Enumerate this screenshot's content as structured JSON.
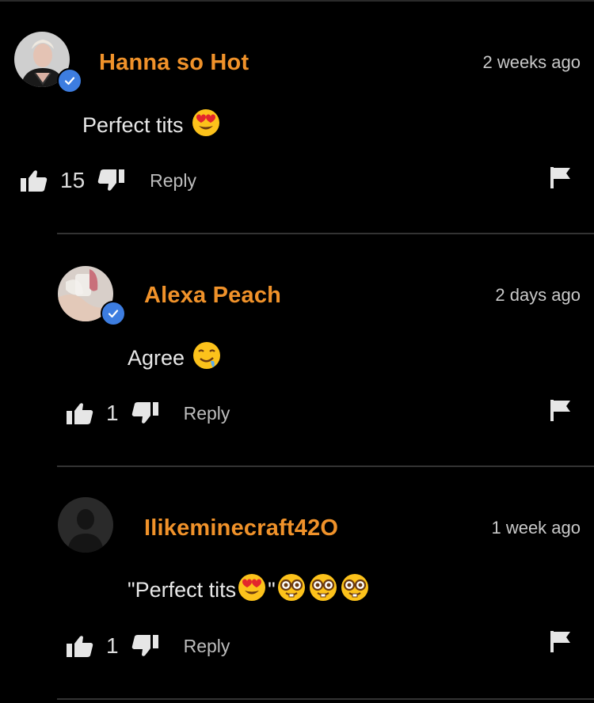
{
  "comments": [
    {
      "username": "Hanna so Hot",
      "time": "2 weeks ago",
      "text": "Perfect tits",
      "likes": "15",
      "reply_label": "Reply",
      "verified": true,
      "avatar": "profile-photo",
      "emojis": [
        "heart-eyes-emoji"
      ]
    },
    {
      "username": "Alexa Peach",
      "time": "2 days ago",
      "text": "Agree",
      "likes": "1",
      "reply_label": "Reply",
      "verified": true,
      "avatar": "profile-photo",
      "emojis": [
        "drooling-face-emoji"
      ]
    },
    {
      "username": "Ilikeminecraft42O",
      "time": "1 week ago",
      "text": "\"Perfect tits",
      "text_suffix": "\"",
      "likes": "1",
      "reply_label": "Reply",
      "verified": false,
      "avatar": "default-silhouette",
      "emojis": [
        "heart-eyes-emoji",
        "nerd-face-emoji",
        "nerd-face-emoji",
        "nerd-face-emoji"
      ]
    }
  ],
  "colors": {
    "background": "#000000",
    "username": "#f0922a",
    "verified_badge": "#3d7de0",
    "divider": "#333333"
  }
}
